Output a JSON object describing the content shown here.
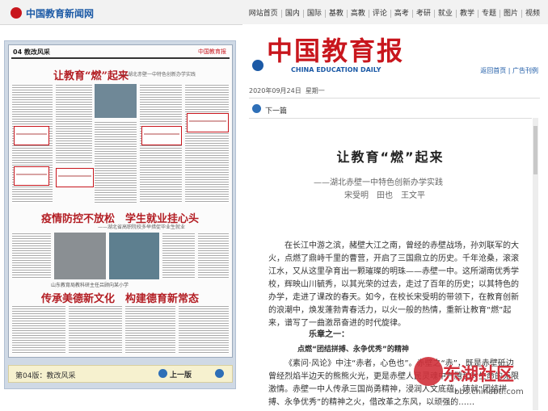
{
  "site": {
    "name": "中国教育新闻网",
    "nav": [
      "网站首页",
      "国内",
      "国际",
      "基教",
      "高教",
      "评论",
      "高考",
      "考研",
      "就业",
      "教学",
      "专题",
      "图片",
      "视频"
    ]
  },
  "left_panel": {
    "page_header": "04 教改风采",
    "masthead_mark": "中国教育报",
    "headline1": "让教育“燃”起来",
    "subhead1": "——湖北赤壁一中特色创新办学实践",
    "headline2": "疫情防控不放松　学生就业挂心头",
    "subhead2": "——湖北省高职院校多举措促毕业生就业",
    "caption": "山东教育局教科研主任吕顾向某小学",
    "headline3": "传承美德新文化　构建德育新常态",
    "footer_edition": "第04版：教改风采",
    "footer_prev": "上一版"
  },
  "right_panel": {
    "masthead_cn": "中国教育报",
    "masthead_en": "CHINA EDUCATION DAILY",
    "links": [
      "返回首页",
      "广告刊例"
    ],
    "date": "2020年09月24日",
    "weekday": "星期一",
    "next_label": "下一篇",
    "article": {
      "title": "让教育“燃”起来",
      "subtitle": "——湖北赤壁一中特色创新办学实践",
      "authors": "宋受明　田也　王文平",
      "intro": "在长江中游之滨，赭壁大江之南，曾经的赤壁战场，孙刘联军的大火，点燃了鼎峙千里的曹营，开启了三国鼎立的历史。千年沧桑，滚滚江水，又从这里孕育出一颗璀璨的明珠——赤壁一中。这所湖南优秀学校，辉映山川毓秀，以其光荣的过去，走过了百年的历史；以其特色的办学，走进了课改的春天。如今，在校长宋受明的带领下，在教育创新的浪潮中，焕发蓬勃青春活力，以火一般的热情，重新让教育“燃”起来，谱写了一曲激昂奋进的时代旋律。",
      "section": "乐章之一：",
      "section_title": "点燃“团结拼搏、永争优秀”的精神",
      "body2": "《素问·风论》中注“赤者，心色也”。赤壁之“赤”，既是赤壁砥边曾经烈焰半边天的熊熊火光，更是赤壁人民灵魂中升腾起对生命的无限激情。赤壁一中人传承三国尚勇精神，浸润人文底蕴，铸就“团结拼搏、永争优秀”的精神之火，借改革之东风，以顽强的……"
    }
  },
  "watermark": {
    "text": "东湖社区",
    "url": "bbs.chinabtl.com"
  }
}
